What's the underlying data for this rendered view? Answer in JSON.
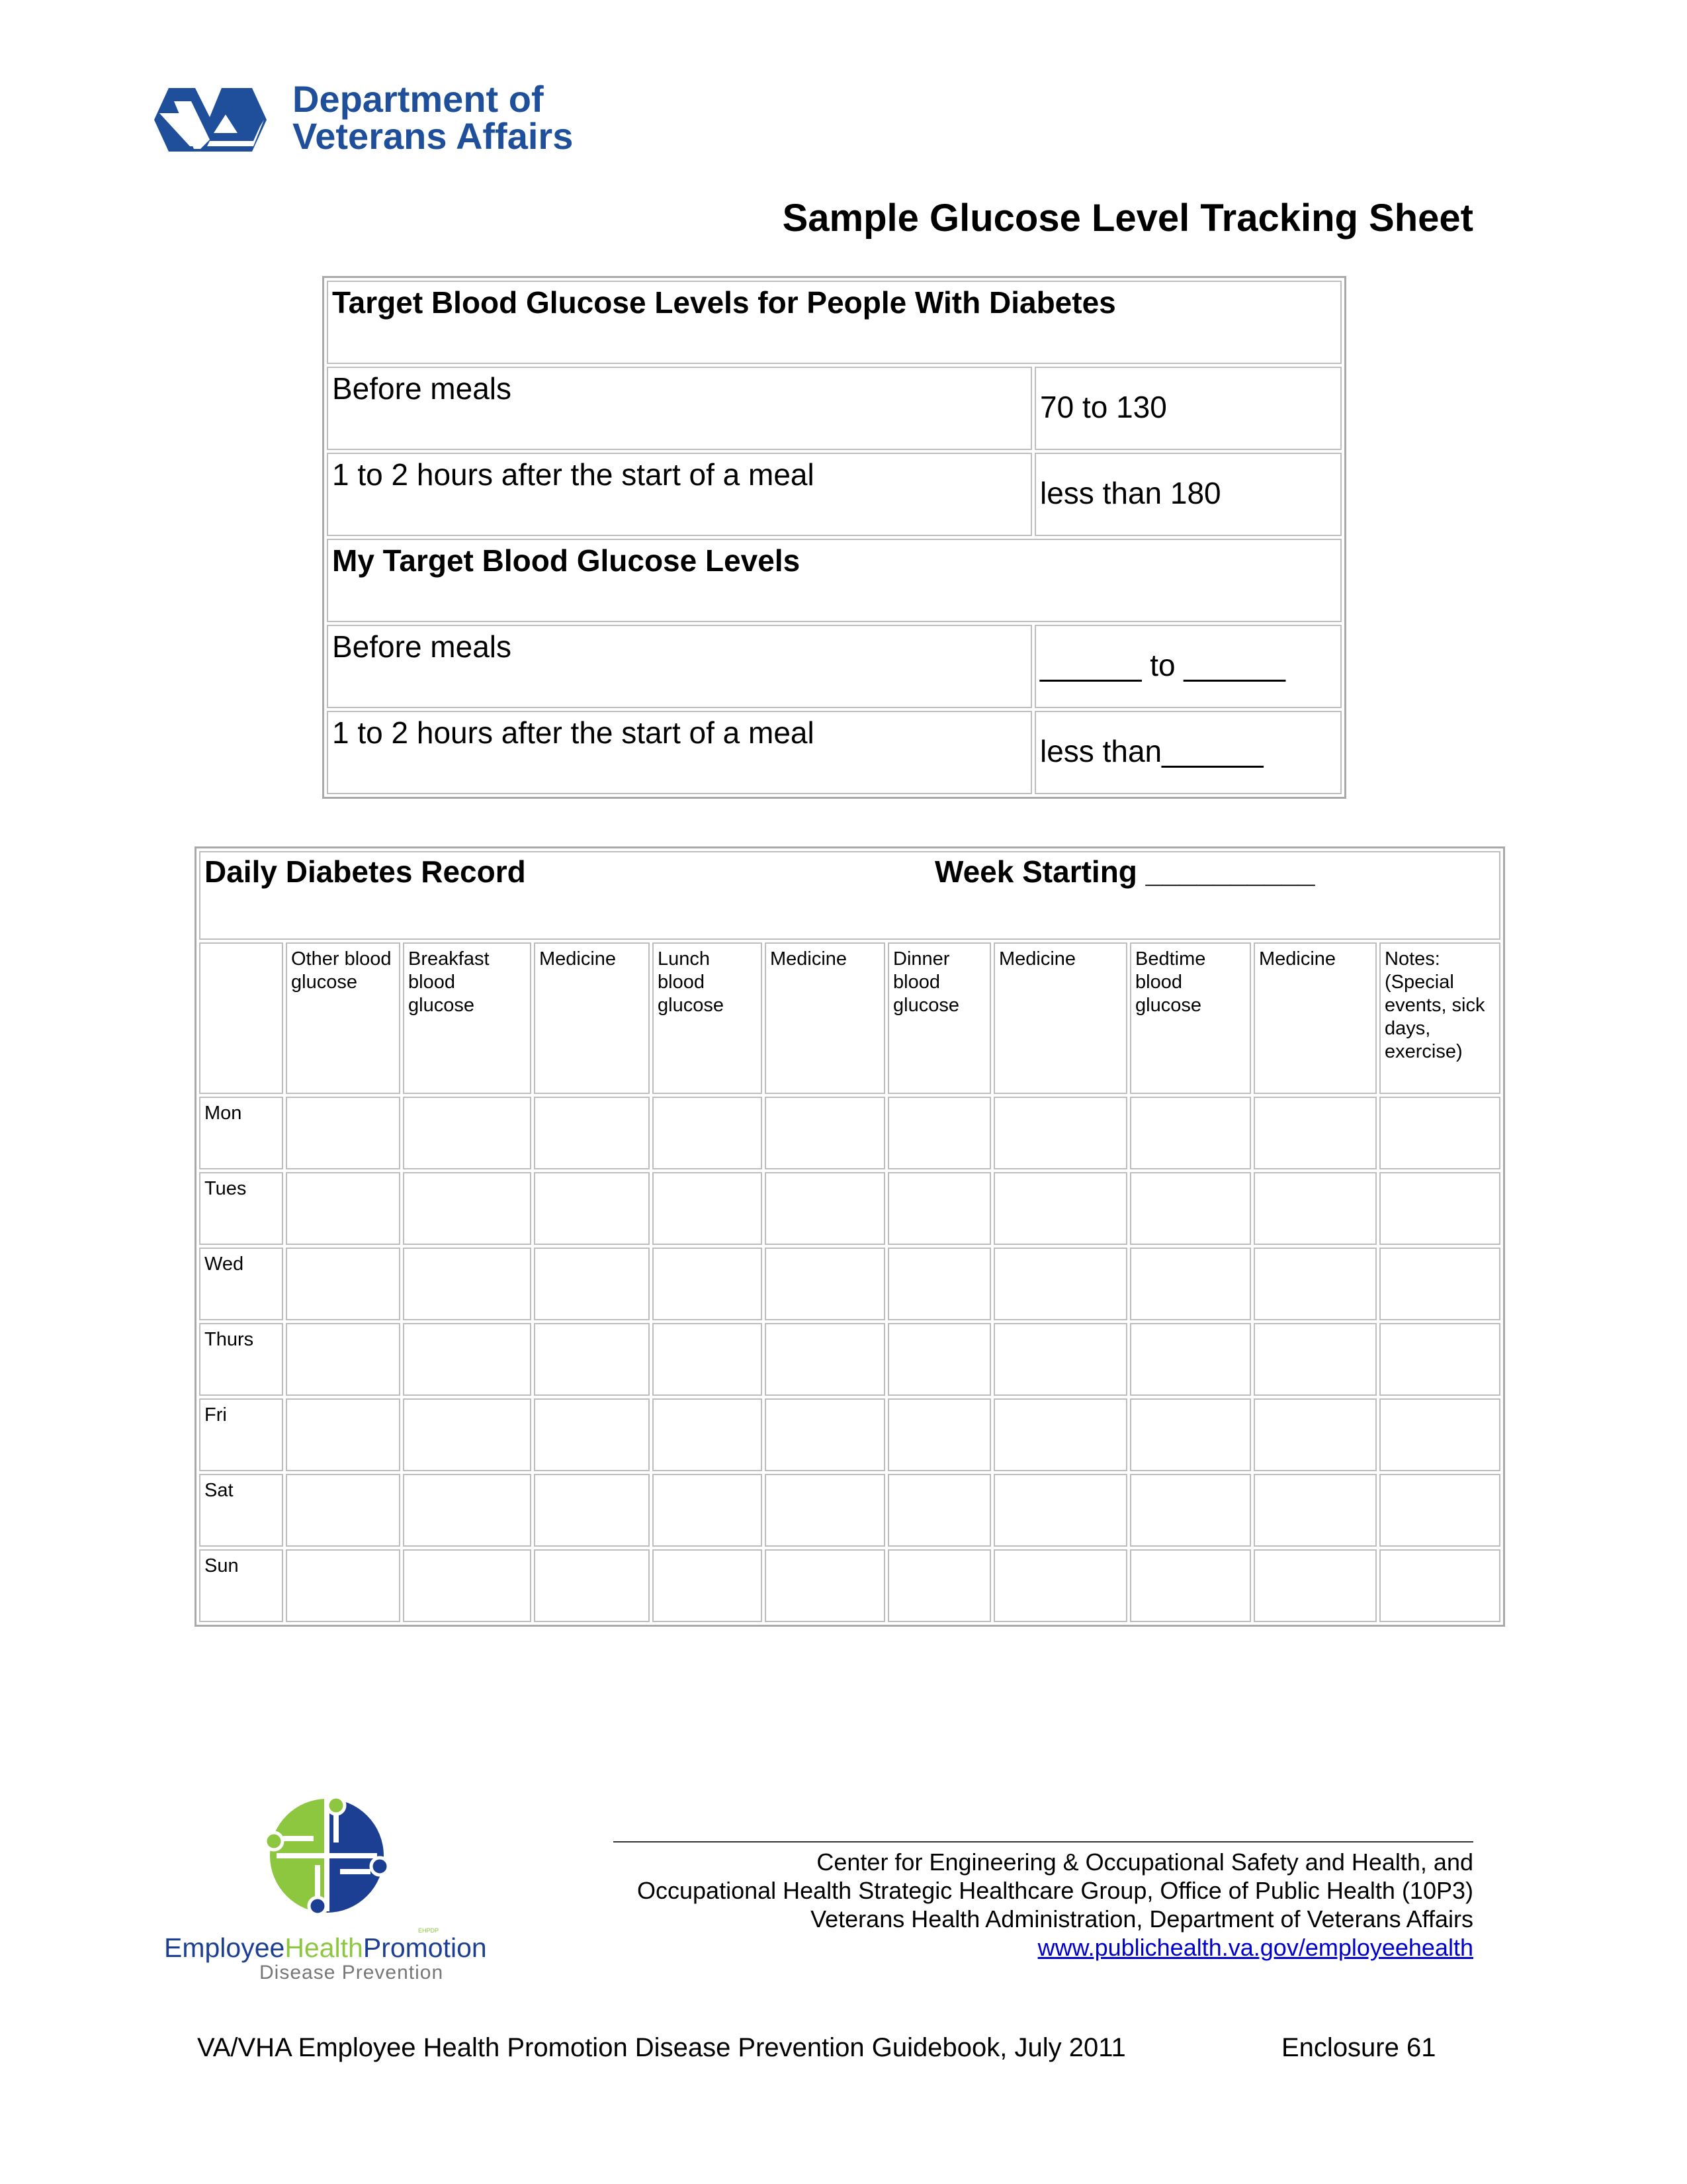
{
  "header": {
    "logo_line1": "Department of",
    "logo_line2": "Veterans Affairs",
    "title": "Sample Glucose Level Tracking Sheet"
  },
  "targets_table": {
    "section1_title": "Target Blood Glucose Levels for People With Diabetes",
    "section1_rows": [
      {
        "label": "Before meals",
        "value": "70 to 130"
      },
      {
        "label": "1 to 2 hours after the start of a meal",
        "value": "less than 180"
      }
    ],
    "section2_title": "My Target Blood Glucose Levels",
    "section2_rows": [
      {
        "label": "Before meals",
        "value": "______ to ______"
      },
      {
        "label": "1 to 2 hours after the start of a meal",
        "value": "less than______"
      }
    ]
  },
  "daily_record": {
    "title": "Daily Diabetes Record",
    "week_label": "Week Starting __________",
    "columns": [
      "",
      "Other blood glucose",
      "Breakfast blood glucose",
      "Medicine",
      "Lunch blood glucose",
      "Medicine",
      "Dinner blood glucose",
      "Medicine",
      "Bedtime blood glucose",
      "Medicine",
      "Notes: (Special events, sick days, exercise)"
    ],
    "days": [
      "Mon",
      "Tues",
      "Wed",
      "Thurs",
      "Fri",
      "Sat",
      "Sun"
    ]
  },
  "footer": {
    "line1": "Center for Engineering & Occupational Safety and Health, and",
    "line2": "Occupational Health Strategic Healthcare Group, Office of Public Health (10P3)",
    "line3": "Veterans Health Administration, Department of Veterans Affairs",
    "link": "www.publichealth.va.gov/employeehealth",
    "ehp_part1": "Employee",
    "ehp_part2": "Health",
    "ehp_part3": "Promotion",
    "ehp_badge": "EHPDP",
    "ehp_sub": "Disease Prevention",
    "guidebook": "VA/VHA Employee Health Promotion Disease Prevention Guidebook, July 2011",
    "enclosure": "Enclosure 61"
  },
  "colors": {
    "va_blue": "#1f4e9a",
    "ehp_green": "#8dc63f",
    "ehp_blue": "#1c3f94"
  }
}
